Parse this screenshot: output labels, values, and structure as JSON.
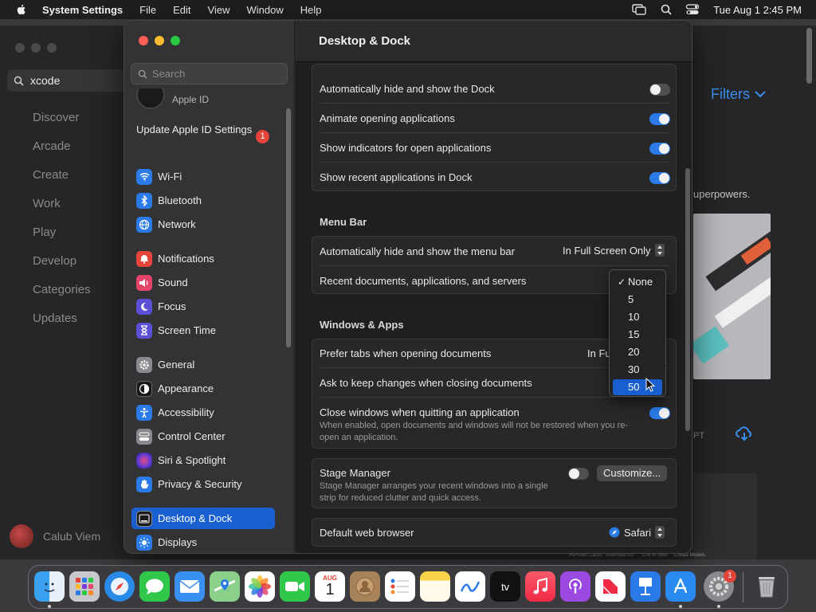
{
  "menubar": {
    "app_name": "System Settings",
    "items": [
      "File",
      "Edit",
      "View",
      "Window",
      "Help"
    ],
    "clock": "Tue Aug 1  2:45 PM"
  },
  "bg_app": {
    "search_value": "xcode",
    "nav": [
      "Discover",
      "Arcade",
      "Create",
      "Work",
      "Play",
      "Develop",
      "Categories",
      "Updates"
    ],
    "user_name": "Calub Viem",
    "filters_label": "Filters",
    "tagline_fragment": "uperpowers.",
    "pt_fragment": "PT",
    "tiny_labels": [
      "ReFotter Cards",
      "Automate Uri",
      "Chit to Swift",
      "Create Models"
    ]
  },
  "settings": {
    "window_title": "Desktop & Dock",
    "search_placeholder": "Search",
    "apple_id_label": "Apple ID",
    "update_label": "Update Apple ID Settings",
    "update_badge": "1",
    "sidebar": [
      {
        "label": "Wi-Fi",
        "icon": "wifi-icon",
        "color": "#2a7ae8"
      },
      {
        "label": "Bluetooth",
        "icon": "bluetooth-icon",
        "color": "#2a7ae8"
      },
      {
        "label": "Network",
        "icon": "globe-icon",
        "color": "#2a7ae8"
      },
      {
        "label": "Notifications",
        "icon": "bell-icon",
        "color": "#e5443a"
      },
      {
        "label": "Sound",
        "icon": "speaker-icon",
        "color": "#e5446a"
      },
      {
        "label": "Focus",
        "icon": "moon-icon",
        "color": "#5b4fd6"
      },
      {
        "label": "Screen Time",
        "icon": "hourglass-icon",
        "color": "#5b4fd6"
      },
      {
        "label": "General",
        "icon": "gear-icon",
        "color": "#8a8a8e"
      },
      {
        "label": "Appearance",
        "icon": "appearance-icon",
        "color": "#1a1a1a"
      },
      {
        "label": "Accessibility",
        "icon": "accessibility-icon",
        "color": "#2a7ae8"
      },
      {
        "label": "Control Center",
        "icon": "control-center-icon",
        "color": "#8a8a8e"
      },
      {
        "label": "Siri & Spotlight",
        "icon": "siri-icon",
        "color": "#7a3ad6"
      },
      {
        "label": "Privacy & Security",
        "icon": "hand-icon",
        "color": "#2a7ae8"
      },
      {
        "label": "Desktop & Dock",
        "icon": "dock-icon",
        "color": "#1a1a1a"
      },
      {
        "label": "Displays",
        "icon": "sun-icon",
        "color": "#2a7ae8"
      }
    ],
    "dock_group": [
      "Automatically hide and show the Dock",
      "Animate opening applications",
      "Show indicators for open applications",
      "Show recent applications in Dock"
    ],
    "dock_toggles": [
      false,
      true,
      true,
      true
    ],
    "menubar_header": "Menu Bar",
    "menubar_rows": [
      {
        "label": "Automatically hide and show the menu bar",
        "value": "In Full Screen Only"
      },
      {
        "label": "Recent documents, applications, and servers",
        "value": "50"
      }
    ],
    "windows_header": "Windows & Apps",
    "windows_rows": [
      {
        "label": "Prefer tabs when opening documents",
        "value": "In Fu"
      },
      {
        "label": "Ask to keep changes when closing documents"
      },
      {
        "label": "Close windows when quitting an application",
        "sub": "When enabled, open documents and windows will not be restored when you re-open an application."
      }
    ],
    "stage_manager": {
      "label": "Stage Manager",
      "sub": "Stage Manager arranges your recent windows into a single strip for reduced clutter and quick access.",
      "button": "Customize..."
    },
    "default_browser": {
      "label": "Default web browser",
      "value": "Safari"
    },
    "dropdown": {
      "options": [
        "None",
        "5",
        "10",
        "15",
        "20",
        "30",
        "50"
      ],
      "checked": "None",
      "highlighted": "50",
      "check_mark": "✓"
    }
  },
  "dock": {
    "apps": [
      "Finder",
      "Launchpad",
      "Safari",
      "Messages",
      "Mail",
      "Maps",
      "Photos",
      "FaceTime",
      "Calendar",
      "Contacts",
      "Reminders",
      "Notes",
      "Freeform",
      "TV",
      "Music",
      "Podcasts",
      "News",
      "Keynote",
      "App Store",
      "System Settings",
      "Trash"
    ],
    "calendar_month": "AUG",
    "calendar_day": "1",
    "tv_label": "tv",
    "settings_badge": "1"
  }
}
